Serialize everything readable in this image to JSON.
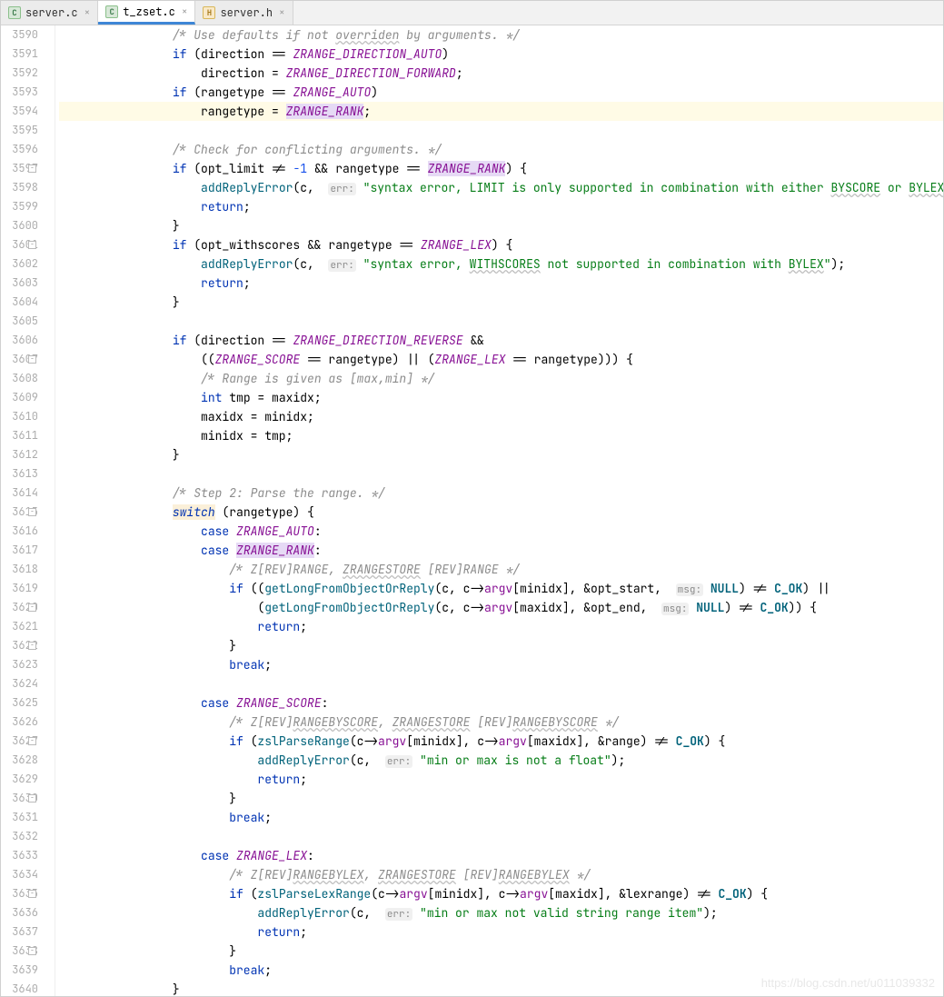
{
  "tabs": [
    {
      "label": "server.c",
      "iconClass": "c",
      "iconText": "C"
    },
    {
      "label": "t_zset.c",
      "iconClass": "c",
      "iconText": "C"
    },
    {
      "label": "server.h",
      "iconClass": "h",
      "iconText": "H"
    }
  ],
  "activeTabIndex": 1,
  "startLine": 3590,
  "endLine": 3640,
  "highlightLine": 3594,
  "foldMarkers": [
    3597,
    3601,
    3607,
    3615,
    3620,
    3622,
    3627,
    3630,
    3635,
    3638
  ],
  "watermark": "https://blog.csdn.net/u011039332",
  "code": [
    {
      "i": 8,
      "t": [
        {
          "c": "comment",
          "s": "/* Use defaults if not "
        },
        {
          "c": "comment uline",
          "s": "overriden"
        },
        {
          "c": "comment",
          "s": " by arguments. */"
        }
      ]
    },
    {
      "i": 8,
      "t": [
        {
          "c": "kw",
          "s": "if"
        },
        {
          "c": "",
          "s": " (direction == "
        },
        {
          "c": "enum",
          "s": "ZRANGE_DIRECTION_AUTO"
        },
        {
          "c": "",
          "s": ")"
        }
      ]
    },
    {
      "i": 12,
      "t": [
        {
          "c": "",
          "s": "direction = "
        },
        {
          "c": "enum",
          "s": "ZRANGE_DIRECTION_FORWARD"
        },
        {
          "c": "",
          "s": ";"
        }
      ]
    },
    {
      "i": 8,
      "t": [
        {
          "c": "kw",
          "s": "if"
        },
        {
          "c": "",
          "s": " (rangetype == "
        },
        {
          "c": "enum",
          "s": "ZRANGE_AUTO"
        },
        {
          "c": "",
          "s": ")"
        }
      ]
    },
    {
      "i": 12,
      "t": [
        {
          "c": "",
          "s": "rangetype = "
        },
        {
          "c": "enum hlword",
          "s": "ZRANGE_RANK"
        },
        {
          "c": "",
          "s": ";"
        }
      ]
    },
    {
      "i": 0,
      "t": []
    },
    {
      "i": 8,
      "t": [
        {
          "c": "comment",
          "s": "/* Check for conflicting arguments. */"
        }
      ]
    },
    {
      "i": 8,
      "t": [
        {
          "c": "kw",
          "s": "if"
        },
        {
          "c": "",
          "s": " (opt_limit != "
        },
        {
          "c": "num",
          "s": "-1"
        },
        {
          "c": "",
          "s": " && rangetype == "
        },
        {
          "c": "enum hlword",
          "s": "ZRANGE_RANK"
        },
        {
          "c": "",
          "s": ") {"
        }
      ]
    },
    {
      "i": 12,
      "t": [
        {
          "c": "fn",
          "s": "addReplyError"
        },
        {
          "c": "",
          "s": "(c,  "
        },
        {
          "c": "arg",
          "s": "err:"
        },
        {
          "c": "",
          "s": " "
        },
        {
          "c": "str",
          "s": "\"syntax error, LIMIT is only supported in combination with either "
        },
        {
          "c": "str uline",
          "s": "BYSCORE"
        },
        {
          "c": "str",
          "s": " or "
        },
        {
          "c": "str uline",
          "s": "BYLEX"
        },
        {
          "c": "str",
          "s": "\""
        },
        {
          "c": "",
          "s": ");"
        }
      ]
    },
    {
      "i": 12,
      "t": [
        {
          "c": "kw",
          "s": "return"
        },
        {
          "c": "",
          "s": ";"
        }
      ]
    },
    {
      "i": 8,
      "t": [
        {
          "c": "",
          "s": "}"
        }
      ]
    },
    {
      "i": 8,
      "t": [
        {
          "c": "kw",
          "s": "if"
        },
        {
          "c": "",
          "s": " (opt_withscores && rangetype == "
        },
        {
          "c": "enum",
          "s": "ZRANGE_LEX"
        },
        {
          "c": "",
          "s": ") {"
        }
      ]
    },
    {
      "i": 12,
      "t": [
        {
          "c": "fn",
          "s": "addReplyError"
        },
        {
          "c": "",
          "s": "(c,  "
        },
        {
          "c": "arg",
          "s": "err:"
        },
        {
          "c": "",
          "s": " "
        },
        {
          "c": "str",
          "s": "\"syntax error, "
        },
        {
          "c": "str uline",
          "s": "WITHSCORES"
        },
        {
          "c": "str",
          "s": " not supported in combination with "
        },
        {
          "c": "str uline",
          "s": "BYLEX"
        },
        {
          "c": "str",
          "s": "\""
        },
        {
          "c": "",
          "s": ");"
        }
      ]
    },
    {
      "i": 12,
      "t": [
        {
          "c": "kw",
          "s": "return"
        },
        {
          "c": "",
          "s": ";"
        }
      ]
    },
    {
      "i": 8,
      "t": [
        {
          "c": "",
          "s": "}"
        }
      ]
    },
    {
      "i": 0,
      "t": []
    },
    {
      "i": 8,
      "t": [
        {
          "c": "kw",
          "s": "if"
        },
        {
          "c": "",
          "s": " (direction == "
        },
        {
          "c": "enum",
          "s": "ZRANGE_DIRECTION_REVERSE"
        },
        {
          "c": "",
          "s": " &&"
        }
      ]
    },
    {
      "i": 12,
      "t": [
        {
          "c": "",
          "s": "(("
        },
        {
          "c": "enum",
          "s": "ZRANGE_SCORE"
        },
        {
          "c": "",
          "s": " == rangetype) || ("
        },
        {
          "c": "enum",
          "s": "ZRANGE_LEX"
        },
        {
          "c": "",
          "s": " == rangetype))) {"
        }
      ]
    },
    {
      "i": 12,
      "t": [
        {
          "c": "comment",
          "s": "/* Range is given as [max,min] */"
        }
      ]
    },
    {
      "i": 12,
      "t": [
        {
          "c": "kw",
          "s": "int"
        },
        {
          "c": "",
          "s": " tmp = maxidx;"
        }
      ]
    },
    {
      "i": 12,
      "t": [
        {
          "c": "",
          "s": "maxidx = minidx;"
        }
      ]
    },
    {
      "i": 12,
      "t": [
        {
          "c": "",
          "s": "minidx = tmp;"
        }
      ]
    },
    {
      "i": 8,
      "t": [
        {
          "c": "",
          "s": "}"
        }
      ]
    },
    {
      "i": 0,
      "t": []
    },
    {
      "i": 8,
      "t": [
        {
          "c": "comment",
          "s": "/* Step 2: Parse the range. */"
        }
      ]
    },
    {
      "i": 8,
      "t": [
        {
          "c": "kwi hlword2",
          "s": "switch"
        },
        {
          "c": "",
          "s": " (rangetype) {"
        }
      ]
    },
    {
      "i": 12,
      "t": [
        {
          "c": "kw",
          "s": "case"
        },
        {
          "c": "",
          "s": " "
        },
        {
          "c": "enum",
          "s": "ZRANGE_AUTO"
        },
        {
          "c": "",
          "s": ":"
        }
      ]
    },
    {
      "i": 12,
      "t": [
        {
          "c": "kw",
          "s": "case"
        },
        {
          "c": "",
          "s": " "
        },
        {
          "c": "enum hlword",
          "s": "ZRANGE_RANK"
        },
        {
          "c": "",
          "s": ":"
        }
      ]
    },
    {
      "i": 16,
      "t": [
        {
          "c": "comment",
          "s": "/* Z[REV]RANGE, "
        },
        {
          "c": "comment uline",
          "s": "ZRANGESTORE"
        },
        {
          "c": "comment",
          "s": " [REV]RANGE */"
        }
      ]
    },
    {
      "i": 16,
      "t": [
        {
          "c": "kw",
          "s": "if"
        },
        {
          "c": "",
          "s": " (("
        },
        {
          "c": "fn",
          "s": "getLongFromObjectOrReply"
        },
        {
          "c": "",
          "s": "(c, c->"
        },
        {
          "c": "field",
          "s": "argv"
        },
        {
          "c": "",
          "s": "[minidx], &opt_start,  "
        },
        {
          "c": "arg",
          "s": "msg:"
        },
        {
          "c": "",
          "s": " "
        },
        {
          "c": "macro",
          "s": "NULL"
        },
        {
          "c": "",
          "s": ") != "
        },
        {
          "c": "macro",
          "s": "C_OK"
        },
        {
          "c": "",
          "s": ") ||"
        }
      ]
    },
    {
      "i": 20,
      "t": [
        {
          "c": "",
          "s": "("
        },
        {
          "c": "fn",
          "s": "getLongFromObjectOrReply"
        },
        {
          "c": "",
          "s": "(c, c->"
        },
        {
          "c": "field",
          "s": "argv"
        },
        {
          "c": "",
          "s": "[maxidx], &opt_end,  "
        },
        {
          "c": "arg",
          "s": "msg:"
        },
        {
          "c": "",
          "s": " "
        },
        {
          "c": "macro",
          "s": "NULL"
        },
        {
          "c": "",
          "s": ") != "
        },
        {
          "c": "macro",
          "s": "C_OK"
        },
        {
          "c": "",
          "s": ")) {"
        }
      ]
    },
    {
      "i": 20,
      "t": [
        {
          "c": "kw",
          "s": "return"
        },
        {
          "c": "",
          "s": ";"
        }
      ]
    },
    {
      "i": 16,
      "t": [
        {
          "c": "",
          "s": "}"
        }
      ]
    },
    {
      "i": 16,
      "t": [
        {
          "c": "kw",
          "s": "break"
        },
        {
          "c": "",
          "s": ";"
        }
      ]
    },
    {
      "i": 0,
      "t": []
    },
    {
      "i": 12,
      "t": [
        {
          "c": "kw",
          "s": "case"
        },
        {
          "c": "",
          "s": " "
        },
        {
          "c": "enum",
          "s": "ZRANGE_SCORE"
        },
        {
          "c": "",
          "s": ":"
        }
      ]
    },
    {
      "i": 16,
      "t": [
        {
          "c": "comment",
          "s": "/* Z[REV]"
        },
        {
          "c": "comment uline",
          "s": "RANGEBYSCORE"
        },
        {
          "c": "comment",
          "s": ", "
        },
        {
          "c": "comment uline",
          "s": "ZRANGESTORE"
        },
        {
          "c": "comment",
          "s": " [REV]"
        },
        {
          "c": "comment uline",
          "s": "RANGEBYSCORE"
        },
        {
          "c": "comment",
          "s": " */"
        }
      ]
    },
    {
      "i": 16,
      "t": [
        {
          "c": "kw",
          "s": "if"
        },
        {
          "c": "",
          "s": " ("
        },
        {
          "c": "fn",
          "s": "zslParseRange"
        },
        {
          "c": "",
          "s": "(c->"
        },
        {
          "c": "field",
          "s": "argv"
        },
        {
          "c": "",
          "s": "[minidx], c->"
        },
        {
          "c": "field",
          "s": "argv"
        },
        {
          "c": "",
          "s": "[maxidx], &range) != "
        },
        {
          "c": "macro",
          "s": "C_OK"
        },
        {
          "c": "",
          "s": ") {"
        }
      ]
    },
    {
      "i": 20,
      "t": [
        {
          "c": "fn",
          "s": "addReplyError"
        },
        {
          "c": "",
          "s": "(c,  "
        },
        {
          "c": "arg",
          "s": "err:"
        },
        {
          "c": "",
          "s": " "
        },
        {
          "c": "str",
          "s": "\"min or max is not a float\""
        },
        {
          "c": "",
          "s": ");"
        }
      ]
    },
    {
      "i": 20,
      "t": [
        {
          "c": "kw",
          "s": "return"
        },
        {
          "c": "",
          "s": ";"
        }
      ]
    },
    {
      "i": 16,
      "t": [
        {
          "c": "",
          "s": "}"
        }
      ]
    },
    {
      "i": 16,
      "t": [
        {
          "c": "kw",
          "s": "break"
        },
        {
          "c": "",
          "s": ";"
        }
      ]
    },
    {
      "i": 0,
      "t": []
    },
    {
      "i": 12,
      "t": [
        {
          "c": "kw",
          "s": "case"
        },
        {
          "c": "",
          "s": " "
        },
        {
          "c": "enum",
          "s": "ZRANGE_LEX"
        },
        {
          "c": "",
          "s": ":"
        }
      ]
    },
    {
      "i": 16,
      "t": [
        {
          "c": "comment",
          "s": "/* Z[REV]"
        },
        {
          "c": "comment uline",
          "s": "RANGEBYLEX"
        },
        {
          "c": "comment",
          "s": ", "
        },
        {
          "c": "comment uline",
          "s": "ZRANGESTORE"
        },
        {
          "c": "comment",
          "s": " [REV]"
        },
        {
          "c": "comment uline",
          "s": "RANGEBYLEX"
        },
        {
          "c": "comment",
          "s": " */"
        }
      ]
    },
    {
      "i": 16,
      "t": [
        {
          "c": "kw",
          "s": "if"
        },
        {
          "c": "",
          "s": " ("
        },
        {
          "c": "fn",
          "s": "zslParseLexRange"
        },
        {
          "c": "",
          "s": "(c->"
        },
        {
          "c": "field",
          "s": "argv"
        },
        {
          "c": "",
          "s": "[minidx], c->"
        },
        {
          "c": "field",
          "s": "argv"
        },
        {
          "c": "",
          "s": "[maxidx], &lexrange) != "
        },
        {
          "c": "macro",
          "s": "C_OK"
        },
        {
          "c": "",
          "s": ") {"
        }
      ]
    },
    {
      "i": 20,
      "t": [
        {
          "c": "fn",
          "s": "addReplyError"
        },
        {
          "c": "",
          "s": "(c,  "
        },
        {
          "c": "arg",
          "s": "err:"
        },
        {
          "c": "",
          "s": " "
        },
        {
          "c": "str",
          "s": "\"min or max not valid string range item\""
        },
        {
          "c": "",
          "s": ");"
        }
      ]
    },
    {
      "i": 20,
      "t": [
        {
          "c": "kw",
          "s": "return"
        },
        {
          "c": "",
          "s": ";"
        }
      ]
    },
    {
      "i": 16,
      "t": [
        {
          "c": "",
          "s": "}"
        }
      ]
    },
    {
      "i": 16,
      "t": [
        {
          "c": "kw",
          "s": "break"
        },
        {
          "c": "",
          "s": ";"
        }
      ]
    },
    {
      "i": 8,
      "t": [
        {
          "c": "",
          "s": "}"
        }
      ]
    }
  ]
}
